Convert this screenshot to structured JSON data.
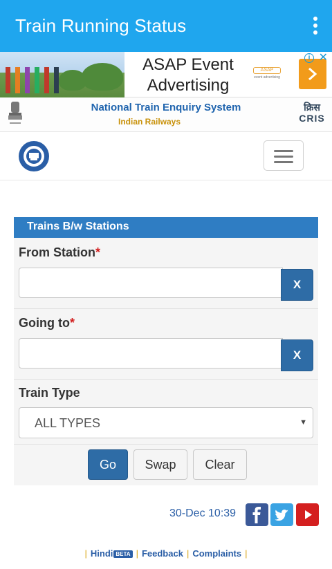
{
  "appbar": {
    "title": "Train Running Status",
    "menu_icon": "more-vert-icon"
  },
  "ad": {
    "line1": "ASAP Event",
    "line2": "Advertising",
    "brand_logo": "ASAP",
    "brand_tagline": "event advertising",
    "info_icon": "ⓘ",
    "close_icon": "✕"
  },
  "ntes_header": {
    "title": "National Train Enquiry System",
    "subtitle": "Indian Railways",
    "cris_hindi": "क्रिस",
    "cris_english": "CRIS"
  },
  "navbar": {
    "logo_icon": "indian-railways-ntes-logo",
    "toggle_icon": "hamburger-icon"
  },
  "form": {
    "heading": "Trains B/w Stations",
    "from_label": "From Station",
    "from_value": "",
    "to_label": "Going to",
    "to_value": "",
    "required_mark": "*",
    "clear_x": "X",
    "train_type_label": "Train Type",
    "train_type_selected": "ALL TYPES",
    "go_label": "Go",
    "swap_label": "Swap",
    "clear_label": "Clear"
  },
  "status": {
    "datetime": "30-Dec 10:39"
  },
  "social": [
    "facebook-icon",
    "twitter-icon",
    "youtube-icon"
  ],
  "footer": {
    "hindi": "Hindi",
    "beta": "BETA",
    "feedback": "Feedback",
    "complaints": "Complaints"
  },
  "colors": {
    "appbar": "#1fa6ee",
    "panel_head": "#2f7dc3",
    "primary_button": "#2e6ca6",
    "required": "#d21f1f"
  }
}
